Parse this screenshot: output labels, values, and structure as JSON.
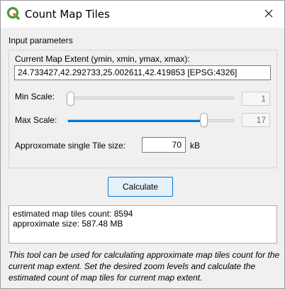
{
  "window": {
    "title": "Count Map Tiles",
    "app_icon": "qgis-icon",
    "close_icon": "close-icon"
  },
  "input_parameters": {
    "section_label": "Input parameters",
    "extent_label": "Current Map Extent (ymin, xmin, ymax, xmax):",
    "extent_value": "24.733427,42.292733,25.002611,42.419853 [EPSG:4326]",
    "min_scale_label": "Min Scale:",
    "min_scale_value": "1",
    "min_scale_level": 0.0,
    "max_scale_label": "Max Scale:",
    "max_scale_value": "17",
    "max_scale_level": 0.81,
    "tile_size_label": "Approxomate single Tile size:",
    "tile_size_value": "70",
    "tile_size_unit": "kB"
  },
  "actions": {
    "calculate_label": "Calculate"
  },
  "results": {
    "tiles_count_line": "estimated map tiles count: 8594",
    "approx_size_line": "approximate size: 587.48 MB"
  },
  "help": {
    "text": "This tool can be used for calculating approximate map tiles count for the current map extent. Set the desired zoom levels and calculate the estimated count of map tiles for current map extent."
  },
  "colors": {
    "accent": "#0078d7",
    "qgis_green": "#589632",
    "qgis_yellow": "#ee7913"
  }
}
